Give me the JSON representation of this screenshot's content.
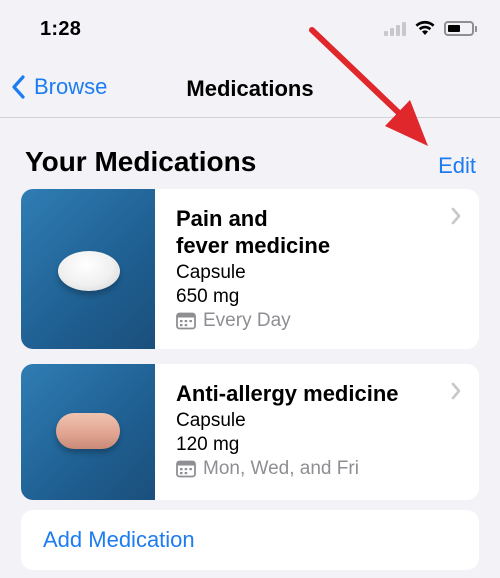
{
  "status_bar": {
    "time": "1:28"
  },
  "nav": {
    "back_label": "Browse",
    "title": "Medications"
  },
  "section": {
    "title": "Your Medications",
    "edit_label": "Edit"
  },
  "medications": [
    {
      "name_line1": "Pain and",
      "name_line2": "fever medicine",
      "form": "Capsule",
      "strength": "650 mg",
      "schedule": "Every Day"
    },
    {
      "name_line1": "Anti-allergy medicine",
      "name_line2": "",
      "form": "Capsule",
      "strength": "120 mg",
      "schedule": "Mon, Wed, and Fri"
    }
  ],
  "add_button": {
    "label": "Add Medication"
  },
  "colors": {
    "accent": "#1e7cf2",
    "background": "#f2f2f7",
    "annotation_arrow": "#e0282c"
  }
}
